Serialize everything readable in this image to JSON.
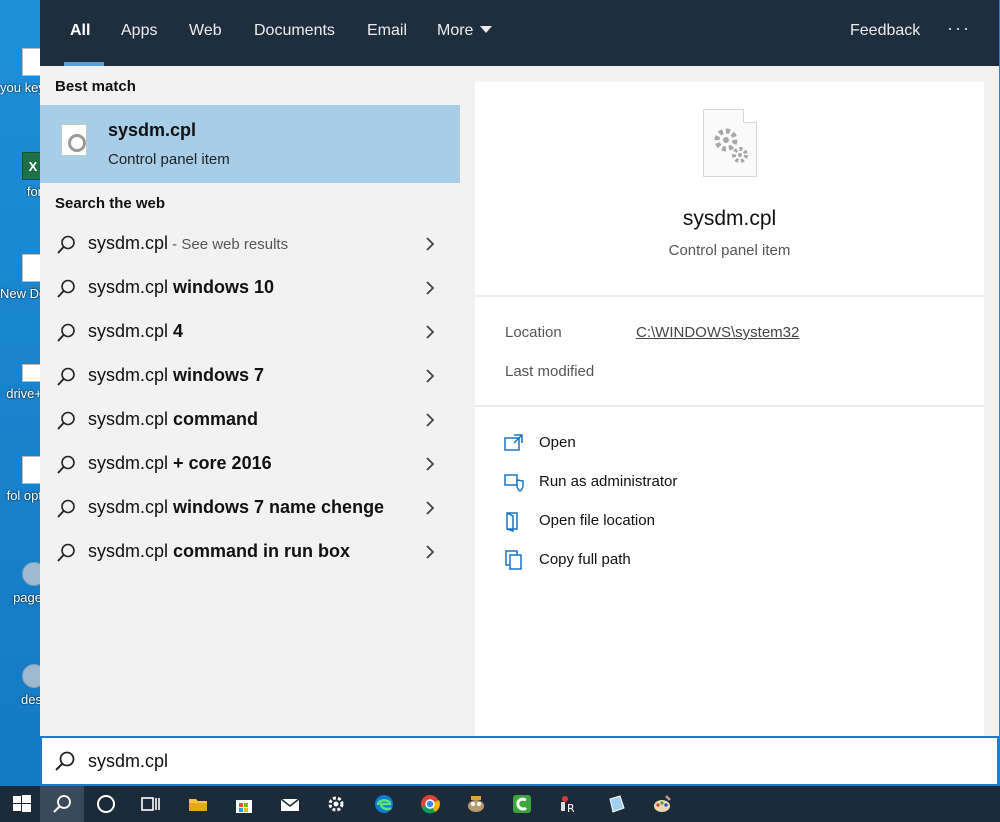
{
  "desktop": {
    "icons": [
      {
        "label": "you keyw",
        "kind": "doc"
      },
      {
        "label": "for",
        "kind": "excel",
        "glyph": "X"
      },
      {
        "label": "New Docu",
        "kind": "doc"
      },
      {
        "label": "drive+",
        "kind": "doc"
      },
      {
        "label": "fol opt",
        "kind": "doc"
      },
      {
        "label": "page",
        "kind": "gear"
      },
      {
        "label": "des",
        "kind": "gear"
      }
    ]
  },
  "tabs": [
    {
      "label": "All",
      "active": true
    },
    {
      "label": "Apps"
    },
    {
      "label": "Web"
    },
    {
      "label": "Documents"
    },
    {
      "label": "Email"
    },
    {
      "label": "More"
    }
  ],
  "topbar": {
    "feedback": "Feedback",
    "more_options": "···"
  },
  "best_match": {
    "header": "Best match",
    "title": "sysdm.cpl",
    "subtitle": "Control panel item",
    "icon": "control-panel-file-icon"
  },
  "web": {
    "header": "Search the web",
    "results": [
      {
        "prefix": "sysdm.cpl",
        "suffix": "",
        "hint": " - See web results"
      },
      {
        "prefix": "sysdm.cpl",
        "suffix": " windows 10",
        "hint": ""
      },
      {
        "prefix": "sysdm.cpl",
        "suffix": " 4",
        "hint": ""
      },
      {
        "prefix": "sysdm.cpl",
        "suffix": " windows 7",
        "hint": ""
      },
      {
        "prefix": "sysdm.cpl",
        "suffix": " command",
        "hint": ""
      },
      {
        "prefix": "sysdm.cpl",
        "suffix": " + core 2016",
        "hint": ""
      },
      {
        "prefix": "sysdm.cpl",
        "suffix": " windows 7 name chenge",
        "hint": ""
      },
      {
        "prefix": "sysdm.cpl",
        "suffix": " command in run box",
        "hint": ""
      }
    ]
  },
  "detail": {
    "title": "sysdm.cpl",
    "subtitle": "Control panel item",
    "location_label": "Location",
    "location_value": "C:\\WINDOWS\\system32",
    "modified_label": "Last modified",
    "actions": [
      {
        "label": "Open",
        "icon": "open-icon"
      },
      {
        "label": "Run as administrator",
        "icon": "shield-icon"
      },
      {
        "label": "Open file location",
        "icon": "folder-location-icon"
      },
      {
        "label": "Copy full path",
        "icon": "copy-icon"
      }
    ]
  },
  "search": {
    "value": "sysdm.cpl"
  },
  "taskbar": {
    "items": [
      "windows-start-icon",
      "search-icon",
      "cortana-icon",
      "task-view-icon",
      "file-explorer-icon",
      "store-icon",
      "mail-icon",
      "settings-icon",
      "edge-icon",
      "chrome-icon",
      "gimp-icon",
      "camtasia-icon",
      "app-r-icon",
      "app-cube-icon",
      "paint-icon"
    ]
  },
  "colors": {
    "accent": "#1f78c8",
    "topbar": "#1f2e3d",
    "selected": "#a8cde6",
    "link": "#1a73c0"
  }
}
